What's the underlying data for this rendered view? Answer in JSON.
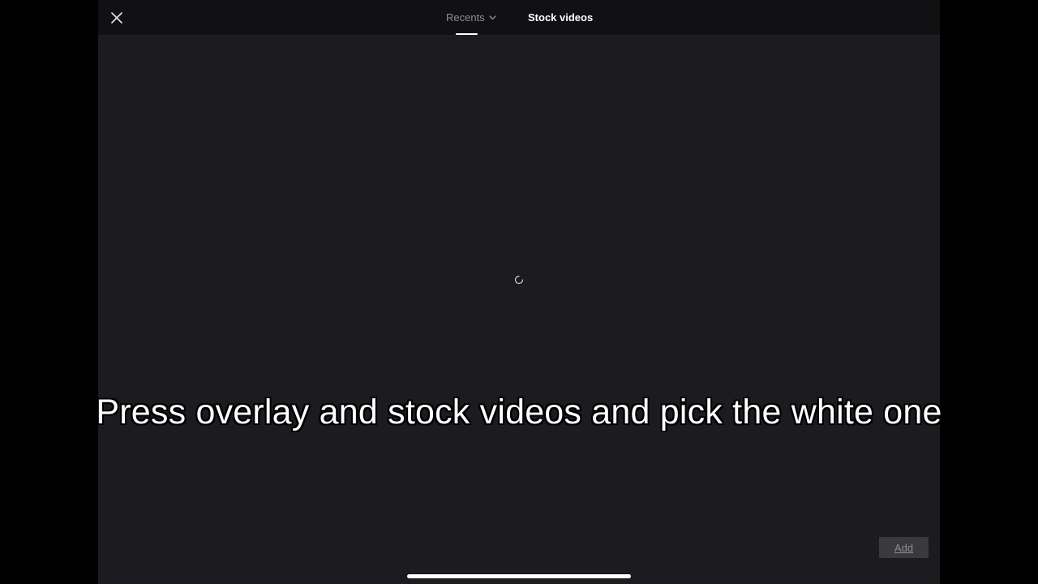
{
  "header": {
    "tabs": [
      {
        "label": "Recents",
        "active": true,
        "has_dropdown": true
      },
      {
        "label": "Stock videos",
        "active": false
      }
    ]
  },
  "icons": {
    "close": "close-icon",
    "chevron": "chevron-down-icon",
    "loading": "loading-spinner-icon"
  },
  "caption": {
    "text": "Press overlay and stock videos and pick the white one"
  },
  "footer": {
    "add_label": "Add"
  },
  "colors": {
    "background": "#000000",
    "panel": "#1c1b1f",
    "topbar": "#111114",
    "inactive_text": "#8e8e93",
    "active_text": "#ffffff",
    "add_button_bg": "#3a3a3c"
  }
}
